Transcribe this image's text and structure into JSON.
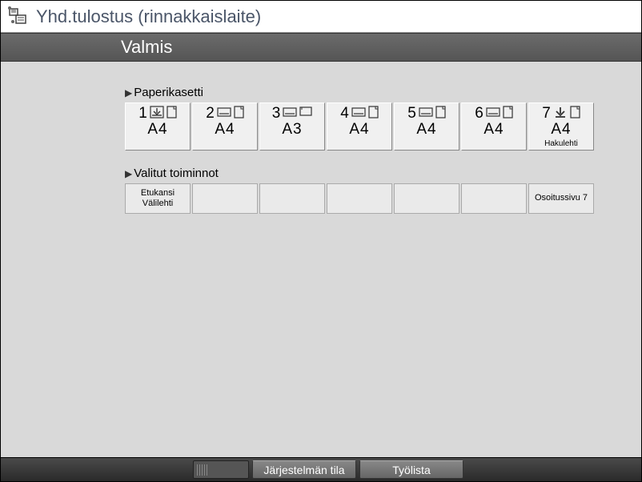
{
  "title": "Yhd.tulostus (rinnakkaislaite)",
  "status": "Valmis",
  "sections": {
    "trays": {
      "header": "Paperikasetti",
      "items": [
        {
          "num": "1",
          "size": "A4",
          "iconA": "down",
          "iconB": "portrait",
          "sub": ""
        },
        {
          "num": "2",
          "size": "A4",
          "iconA": "landscape",
          "iconB": "portrait",
          "sub": ""
        },
        {
          "num": "3",
          "size": "A3",
          "iconA": "landscape",
          "iconB": "landscape-wide",
          "sub": ""
        },
        {
          "num": "4",
          "size": "A4",
          "iconA": "landscape",
          "iconB": "portrait",
          "sub": ""
        },
        {
          "num": "5",
          "size": "A4",
          "iconA": "landscape",
          "iconB": "portrait",
          "sub": ""
        },
        {
          "num": "6",
          "size": "A4",
          "iconA": "landscape",
          "iconB": "portrait",
          "sub": ""
        },
        {
          "num": "7",
          "size": "A4",
          "iconA": "down-arrow",
          "iconB": "portrait",
          "sub": "Hakulehti"
        }
      ]
    },
    "functions": {
      "header": "Valitut toiminnot",
      "items": [
        {
          "line1": "Etukansi",
          "line2": "Välilehti"
        },
        {
          "line1": "",
          "line2": ""
        },
        {
          "line1": "",
          "line2": ""
        },
        {
          "line1": "",
          "line2": ""
        },
        {
          "line1": "",
          "line2": ""
        },
        {
          "line1": "",
          "line2": ""
        },
        {
          "line1": "Osoitussivu 7",
          "line2": ""
        }
      ]
    }
  },
  "bottom": {
    "system": "Järjestelmän tila",
    "joblist": "Työlista"
  }
}
